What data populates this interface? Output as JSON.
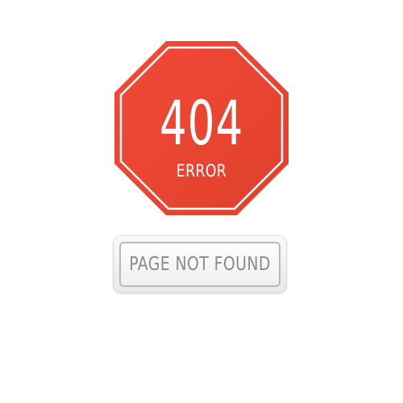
{
  "error_sign": {
    "code": "404",
    "label": "ERROR",
    "color": "#ee4433"
  },
  "message": {
    "text": "PAGE NOT FOUND"
  }
}
